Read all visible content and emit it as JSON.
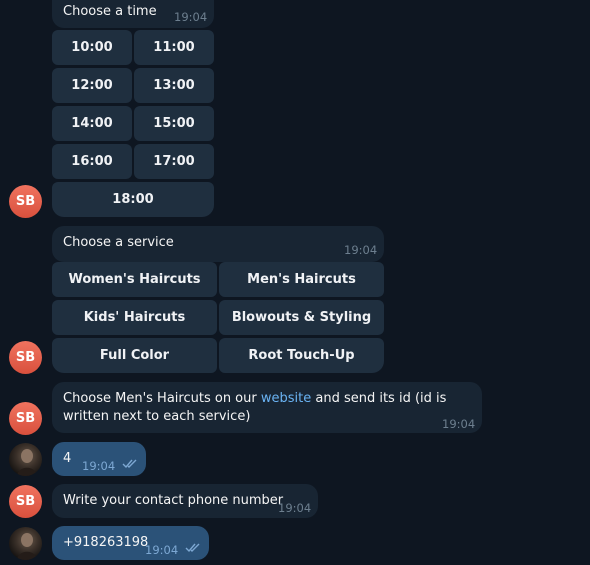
{
  "colors": {
    "background": "#0e1621",
    "incoming_bubble": "#182533",
    "outgoing_bubble": "#2b5278",
    "button": "#1f2f3f",
    "link": "#6ab3f3",
    "avatar": "#e8604c"
  },
  "bot_avatar_initials": "SB",
  "time_picker": {
    "prompt": "Choose a time",
    "time": "19:04",
    "options": [
      "10:00",
      "11:00",
      "12:00",
      "13:00",
      "14:00",
      "15:00",
      "16:00",
      "17:00",
      "18:00"
    ]
  },
  "service_picker": {
    "prompt": "Choose a service",
    "time": "19:04",
    "options": [
      "Women's Haircuts",
      "Men's Haircuts",
      "Kids' Haircuts",
      "Blowouts & Styling",
      "Full Color",
      "Root Touch-Up"
    ]
  },
  "service_info": {
    "text_before": "Choose Men's Haircuts on our ",
    "link_text": "website",
    "text_after": " and send its id (id is written next to each service)",
    "time": "19:04"
  },
  "user_reply_1": {
    "text": "4",
    "time": "19:04"
  },
  "contact_prompt": {
    "text": "Write your contact phone number",
    "time": "19:04"
  },
  "user_reply_2": {
    "text": "+918263198",
    "time": "19:04"
  }
}
